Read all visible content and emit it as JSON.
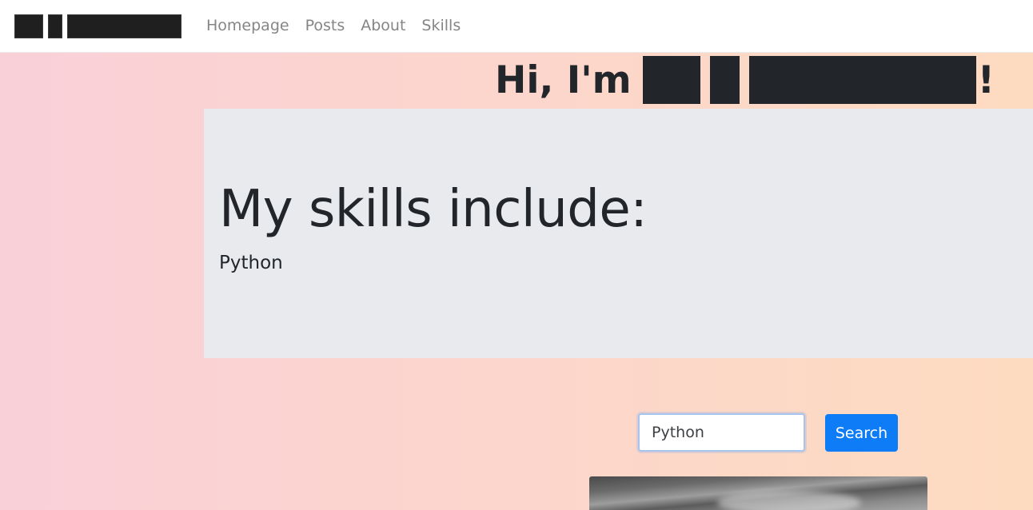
{
  "navbar": {
    "brand_redacted": true,
    "links": [
      "Homepage",
      "Posts",
      "About",
      "Skills"
    ]
  },
  "hero": {
    "greeting_prefix": "Hi, I'm",
    "greeting_suffix": "!",
    "name_redacted": true
  },
  "jumbotron": {
    "heading": "My skills include:",
    "skill": "Python"
  },
  "search": {
    "value": "Python",
    "button_label": "Search"
  },
  "colors": {
    "accent": "#0d7cf6",
    "jumbotron_bg": "#e8eaee",
    "text_dark": "#22252a",
    "nav_link": "#858585"
  }
}
